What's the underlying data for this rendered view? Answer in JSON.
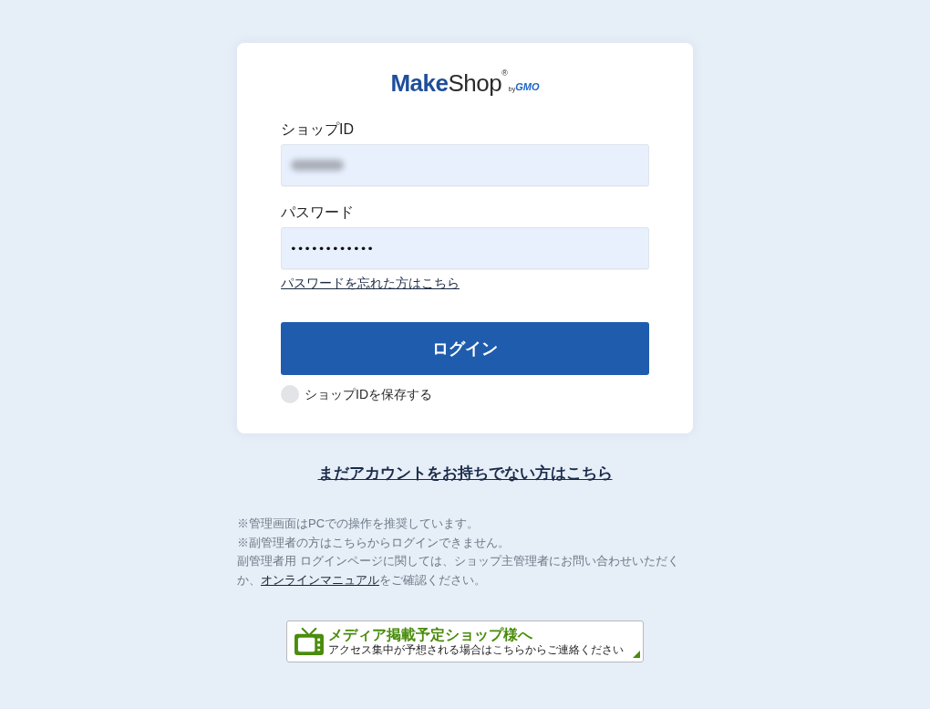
{
  "logo": {
    "part_1": "Make",
    "part_2": "Shop",
    "registered": "®",
    "by": "by",
    "company": "GMO"
  },
  "login_form": {
    "shop_id": {
      "label": "ショップID",
      "value_blurred": true
    },
    "password": {
      "label": "パスワード",
      "value": "••••••••••••"
    },
    "forgot_link": "パスワードを忘れた方はこちら",
    "login_button": "ログイン",
    "remember": {
      "label": "ショップIDを保存する",
      "checked": false
    }
  },
  "signup_link": "まだアカウントをお持ちでない方はこちら",
  "notes": [
    {
      "kind": "plain",
      "text": "※管理画面はPCでの操作を推奨しています。"
    },
    {
      "kind": "plain",
      "text": "※副管理者の方はこちらからログインできません。"
    },
    {
      "kind": "with_link",
      "before": "副管理者用 ログインページに関しては、ショップ主管理者にお問い合わせいただくか、",
      "link": "オンラインマニュアル",
      "after": "をご確認ください。"
    }
  ],
  "media_banner": {
    "title": "メディア掲載予定ショップ様へ",
    "subtitle": "アクセス集中が予想される場合はこちらからご連絡ください"
  }
}
